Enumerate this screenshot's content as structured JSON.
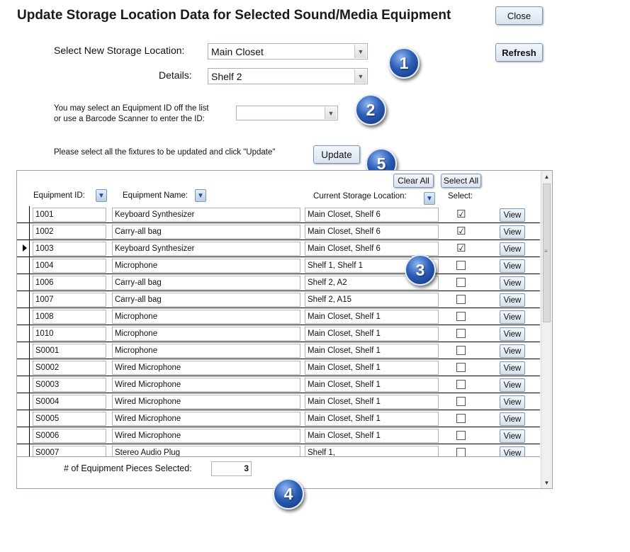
{
  "title": "Update Storage Location Data for Selected Sound/Media Equipment",
  "buttons": {
    "close": "Close",
    "refresh": "Refresh",
    "update": "Update",
    "clear_all": "Clear All",
    "select_all": "Select All"
  },
  "location": {
    "select_label": "Select New Storage Location:",
    "select_value": "Main Closet",
    "details_label": "Details:",
    "details_value": "Shelf 2"
  },
  "id_entry": {
    "line1": "You may select an Equipment ID off the list",
    "line2": "or use a Barcode Scanner to enter the ID:",
    "value": ""
  },
  "instructions": "Please select all the fixtures to be updated and click \"Update\"",
  "badges": {
    "b1": "1",
    "b2": "2",
    "b3": "3",
    "b4": "4",
    "b5": "5"
  },
  "columns": {
    "equipment_id": "Equipment ID:",
    "equipment_name": "Equipment Name:",
    "current_location": "Current Storage Location:",
    "select": "Select:"
  },
  "rows": [
    {
      "id": "1001",
      "name": "Keyboard Synthesizer",
      "location": "Main Closet, Shelf 6",
      "checked": "☑",
      "view": "View"
    },
    {
      "id": "1002",
      "name": "Carry-all bag",
      "location": "Main Closet, Shelf 6",
      "checked": "☑",
      "view": "View"
    },
    {
      "id": "1003",
      "name": "Keyboard Synthesizer",
      "location": "Main Closet, Shelf 6",
      "checked": "☑",
      "view": "View"
    },
    {
      "id": "1004",
      "name": "Microphone",
      "location": "Shelf 1, Shelf 1",
      "checked": "",
      "view": "View"
    },
    {
      "id": "1006",
      "name": "Carry-all bag",
      "location": "Shelf 2, A2",
      "checked": "",
      "view": "View"
    },
    {
      "id": "1007",
      "name": "Carry-all bag",
      "location": "Shelf 2, A15",
      "checked": "",
      "view": "View"
    },
    {
      "id": "1008",
      "name": "Microphone",
      "location": "Main Closet, Shelf 1",
      "checked": "",
      "view": "View"
    },
    {
      "id": "1010",
      "name": "Microphone",
      "location": "Main Closet, Shelf 1",
      "checked": "",
      "view": "View"
    },
    {
      "id": "S0001",
      "name": "Microphone",
      "location": "Main Closet, Shelf 1",
      "checked": "",
      "view": "View"
    },
    {
      "id": "S0002",
      "name": "Wired Microphone",
      "location": "Main Closet, Shelf 1",
      "checked": "",
      "view": "View"
    },
    {
      "id": "S0003",
      "name": "Wired Microphone",
      "location": "Main Closet, Shelf 1",
      "checked": "",
      "view": "View"
    },
    {
      "id": "S0004",
      "name": "Wired Microphone",
      "location": "Main Closet, Shelf 1",
      "checked": "",
      "view": "View"
    },
    {
      "id": "S0005",
      "name": "Wired Microphone",
      "location": "Main Closet, Shelf 1",
      "checked": "",
      "view": "View"
    },
    {
      "id": "S0006",
      "name": "Wired Microphone",
      "location": "Main Closet, Shelf 1",
      "checked": "",
      "view": "View"
    },
    {
      "id": "S0007",
      "name": "Stereo Audio Plug",
      "location": "Shelf 1,",
      "checked": "",
      "view": "View"
    }
  ],
  "current_row_index": 2,
  "count": {
    "label": "# of Equipment Pieces Selected:",
    "value": "3"
  },
  "icons": {
    "combo_arrow": "chevron-down-icon",
    "sort": "sort-arrow-icon",
    "record_pointer": "record-pointer-icon"
  },
  "colors": {
    "button_border": "#7a94b4",
    "badge_blue": "#2c5fb8",
    "sort_blue": "#1f4e9c"
  }
}
